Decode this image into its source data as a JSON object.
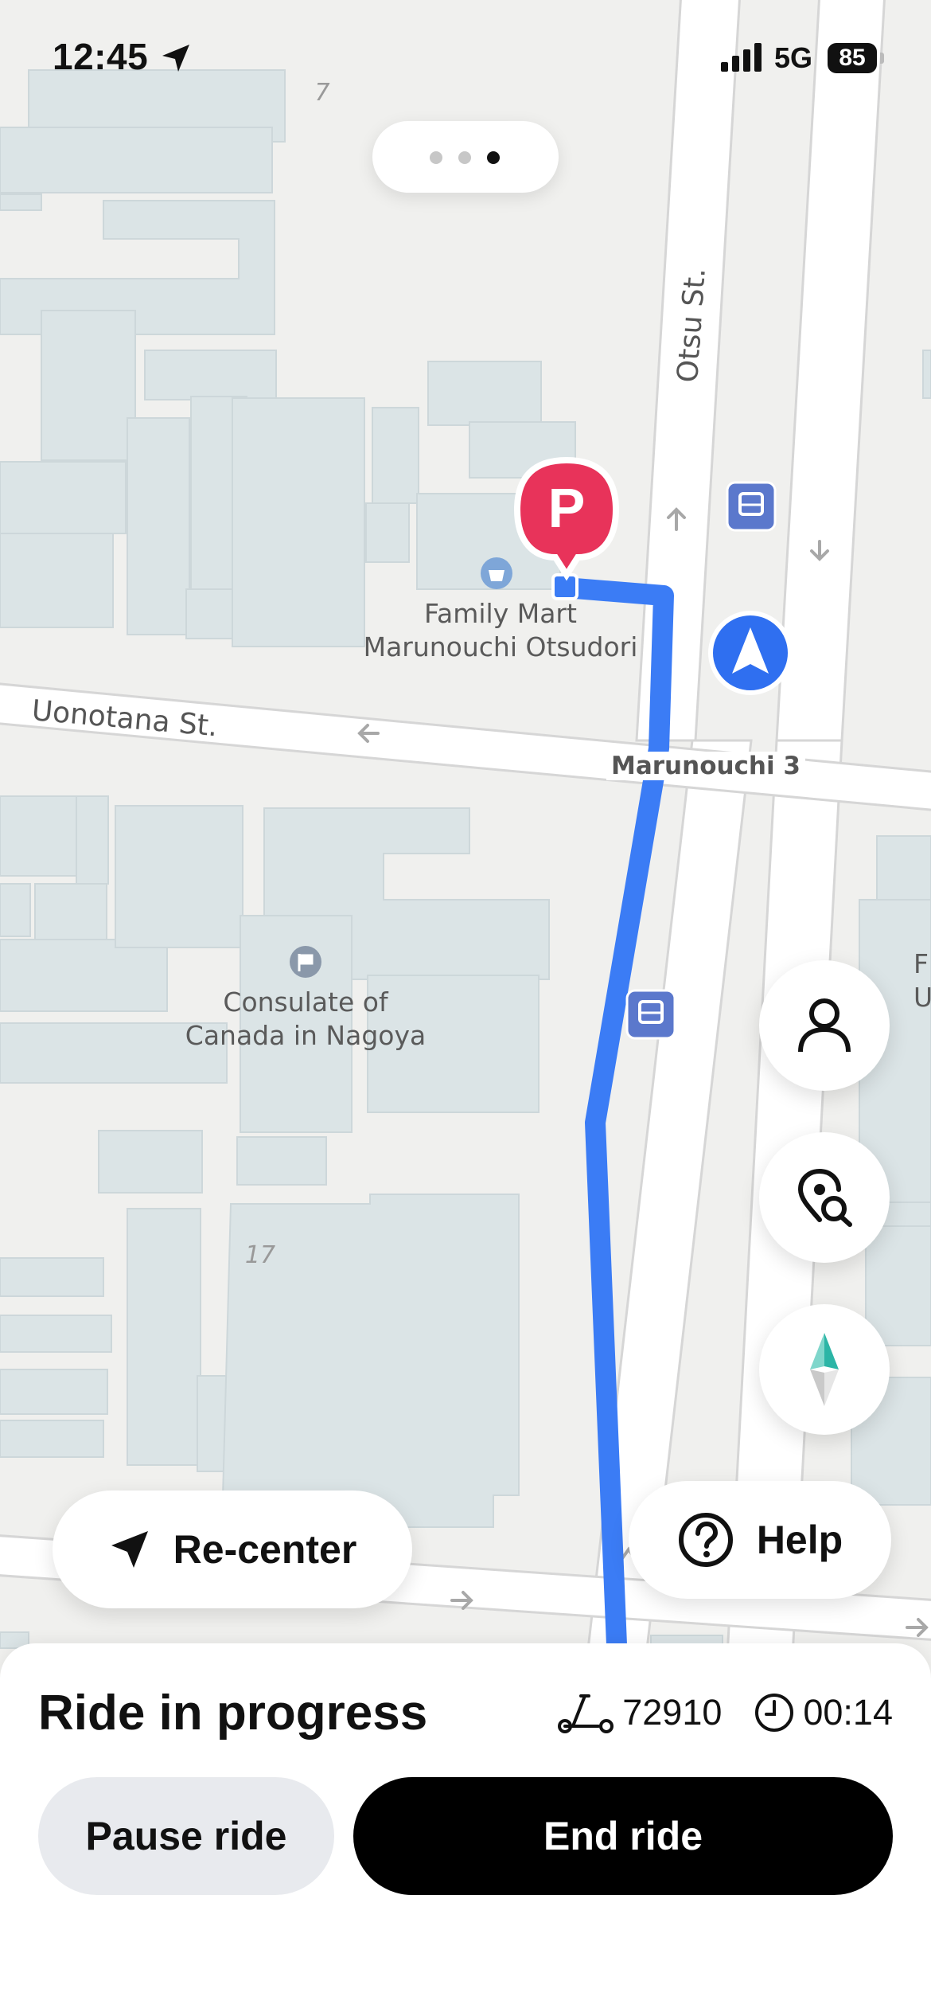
{
  "status_bar": {
    "time": "12:45",
    "network": "5G",
    "battery": "85"
  },
  "pager": {
    "count": 3,
    "active_index": 2
  },
  "map": {
    "building_numbers": [
      "7",
      "17"
    ],
    "streets": {
      "otsu": "Otsu St.",
      "uonotana": "Uonotana St.",
      "intersection": "Marunouchi 3"
    },
    "pois": {
      "family_mart": [
        "Family Mart",
        "Marunouchi Otsudori"
      ],
      "consulate": [
        "Consulate of",
        "Canada in Nagoya"
      ],
      "edge_partial": [
        "F",
        "U"
      ]
    },
    "parking_marker": "P",
    "route_color": "#3b7cf5",
    "parking_color": "#e8335a",
    "location_color": "#2f6ff0"
  },
  "controls": {
    "recenter_label": "Re-center",
    "help_label": "Help",
    "profile_icon": "person-icon",
    "search_place_icon": "map-pin-search-icon",
    "compass_icon": "compass-icon"
  },
  "ride": {
    "title": "Ride in progress",
    "vehicle_id": "72910",
    "elapsed": "00:14",
    "pause_label": "Pause ride",
    "end_label": "End ride"
  }
}
